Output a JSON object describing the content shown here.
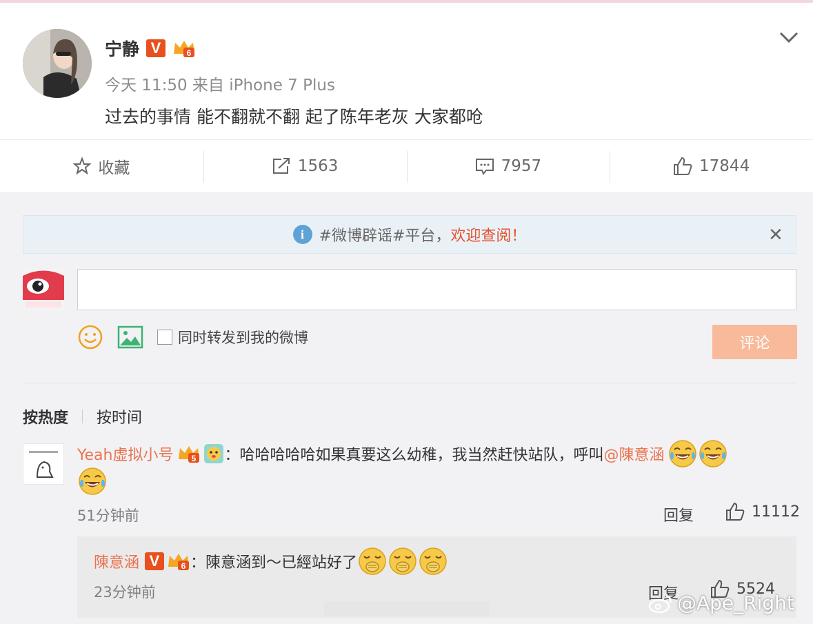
{
  "post": {
    "author": "宁静",
    "meta": "今天 11:50 来自 iPhone 7 Plus",
    "text": "过去的事情 能不翻就不翻 起了陈年老灰 大家都呛"
  },
  "actions": {
    "favorite": "收藏",
    "repost": "1563",
    "comment": "7957",
    "like": "17844"
  },
  "notice": {
    "text": "#微博辟谣#平台，",
    "link": "欢迎查阅！"
  },
  "composer": {
    "repost_label": "同时转发到我的微博",
    "submit_label": "评论"
  },
  "sort": {
    "hot": "按热度",
    "time": "按时间"
  },
  "comment": {
    "user": "Yeah虚拟小号",
    "text": "：哈哈哈哈哈如果真要这么幼稚，我当然赶快站队，呼叫",
    "mention": "@陳意涵",
    "time": "51分钟前",
    "reply_label": "回复",
    "likes": "11112"
  },
  "subreply": {
    "user": "陳意涵",
    "text": "：陳意涵到～已經站好了",
    "time": "23分钟前",
    "reply_label": "回复",
    "likes": "5524"
  },
  "watermark": "@Ape_Right",
  "colors": {
    "accent": "#eb7350",
    "vbadge": "#e8501e",
    "submit_disabled": "#f9b99b"
  }
}
